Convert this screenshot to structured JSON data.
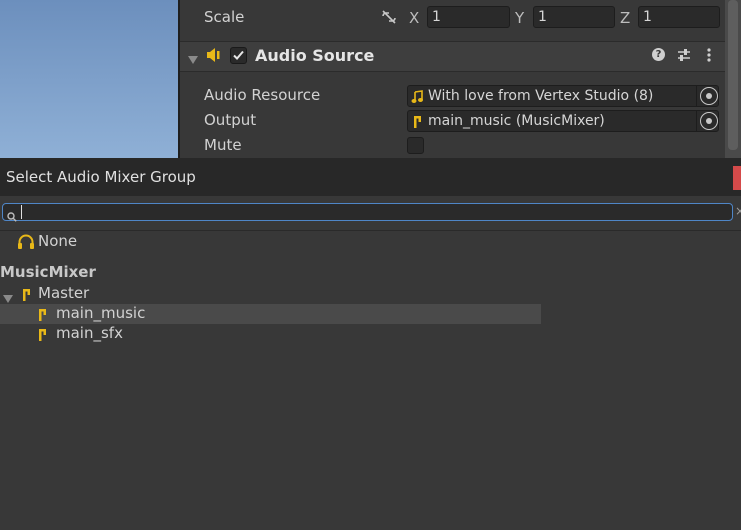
{
  "inspector": {
    "scale": {
      "label": "Scale",
      "x_label": "X",
      "x": "1",
      "y_label": "Y",
      "y": "1",
      "z_label": "Z",
      "z": "1"
    },
    "component": {
      "title": "Audio Source",
      "enabled": true
    },
    "fields": {
      "audio_resource_label": "Audio Resource",
      "audio_resource_value": "With love from Vertex Studio (8)",
      "output_label": "Output",
      "output_value": "main_music (MusicMixer)",
      "mute_label": "Mute"
    }
  },
  "popup": {
    "title": "Select Audio Mixer Group",
    "search": {
      "value": "",
      "placeholder": ""
    },
    "none_label": "None",
    "mixer_name": "MusicMixer",
    "tree": {
      "root": "Master",
      "children": [
        "main_music",
        "main_sfx"
      ],
      "selected": "main_music"
    }
  },
  "colors": {
    "accent": "#4f86c7",
    "icon_yellow": "#e8b818",
    "close_red": "#d44a4a"
  }
}
